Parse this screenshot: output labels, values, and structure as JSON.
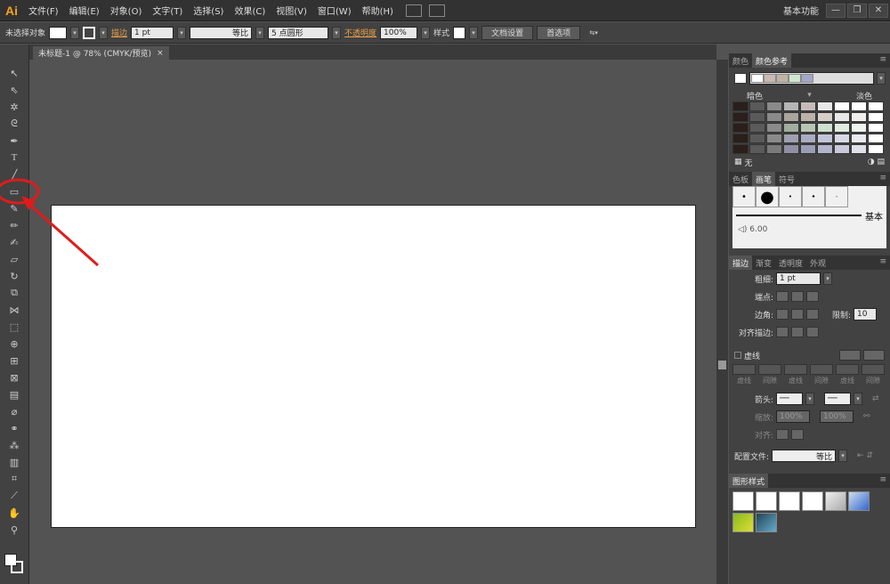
{
  "app": {
    "logo": "Ai"
  },
  "menu": [
    "文件(F)",
    "编辑(E)",
    "对象(O)",
    "文字(T)",
    "选择(S)",
    "效果(C)",
    "视图(V)",
    "窗口(W)",
    "帮助(H)"
  ],
  "workspace": "基本功能",
  "window_buttons": [
    "—",
    "❐",
    "✕"
  ],
  "control": {
    "selection": "未选择对象",
    "stroke_label": "描边",
    "stroke_weight": "1 pt",
    "profile": "等比",
    "brush": "5 点圆形",
    "opacity_label": "不透明度",
    "opacity": "100%",
    "style_label": "样式",
    "doc_setup": "文档设置",
    "prefs": "首选项"
  },
  "document": {
    "tab": "未标题-1 @ 78% (CMYK/预览)",
    "close": "×"
  },
  "color_panel": {
    "tabs": [
      "颜色",
      "颜色参考"
    ],
    "dark_label": "暗色",
    "light_label": "淡色",
    "none_label": "无",
    "strip_colors": [
      "#ffffff",
      "#c9b9b2",
      "#bfb3a4",
      "#cfe6cf",
      "#a3a7c9"
    ],
    "grid_colors": [
      [
        "#2a1f1a",
        "#5a5a5a",
        "#8a8a8a",
        "#b5b5b5",
        "#c5bcb9",
        "#e8e8e8",
        "#ffffff",
        "#ffffff",
        "#ffffff"
      ],
      [
        "#2a1f1a",
        "#5a5a5a",
        "#8a8a8a",
        "#aaa39e",
        "#bdb2a9",
        "#d7d0c9",
        "#e8e8e8",
        "#f1efeb",
        "#ffffff"
      ],
      [
        "#2a1f1a",
        "#5a5a5a",
        "#8a8a8a",
        "#a3ad9f",
        "#b9c5b4",
        "#cfe0ce",
        "#e0ece0",
        "#eef4ee",
        "#ffffff"
      ],
      [
        "#2a1f1a",
        "#5a5a5a",
        "#8a8a8a",
        "#9f9fb1",
        "#a9abc3",
        "#c2c4d9",
        "#d8d9e6",
        "#e9eaf2",
        "#ffffff"
      ],
      [
        "#2a1f1a",
        "#5a5a5a",
        "#7a7a7a",
        "#8f90a3",
        "#9b9db6",
        "#b2b4cc",
        "#c8c9dc",
        "#dfe0ea",
        "#ffffff"
      ]
    ]
  },
  "brush_panel": {
    "tabs": [
      "色板",
      "画笔",
      "符号"
    ],
    "basic": "基本",
    "size": "6.00"
  },
  "stroke_panel": {
    "tabs": [
      "描边",
      "渐变",
      "透明度",
      "外观"
    ],
    "weight_label": "粗细:",
    "weight": "1 pt",
    "cap_label": "端点:",
    "corner_label": "边角:",
    "limit_label": "限制:",
    "limit": "10",
    "align_label": "对齐描边:",
    "dashed_label": "虚线",
    "dash_labels": [
      "虚线",
      "间隙",
      "虚线",
      "间隙",
      "虚线",
      "间隙"
    ],
    "arrow_label": "箭头:",
    "scale_label": "缩放:",
    "scale_start": "100%",
    "scale_end": "100%",
    "align2_label": "对齐:",
    "profile_label": "配置文件:",
    "profile": "等比"
  },
  "graphic_styles": {
    "tab": "图形样式"
  },
  "annotation": {
    "color": "#e01b1b"
  }
}
